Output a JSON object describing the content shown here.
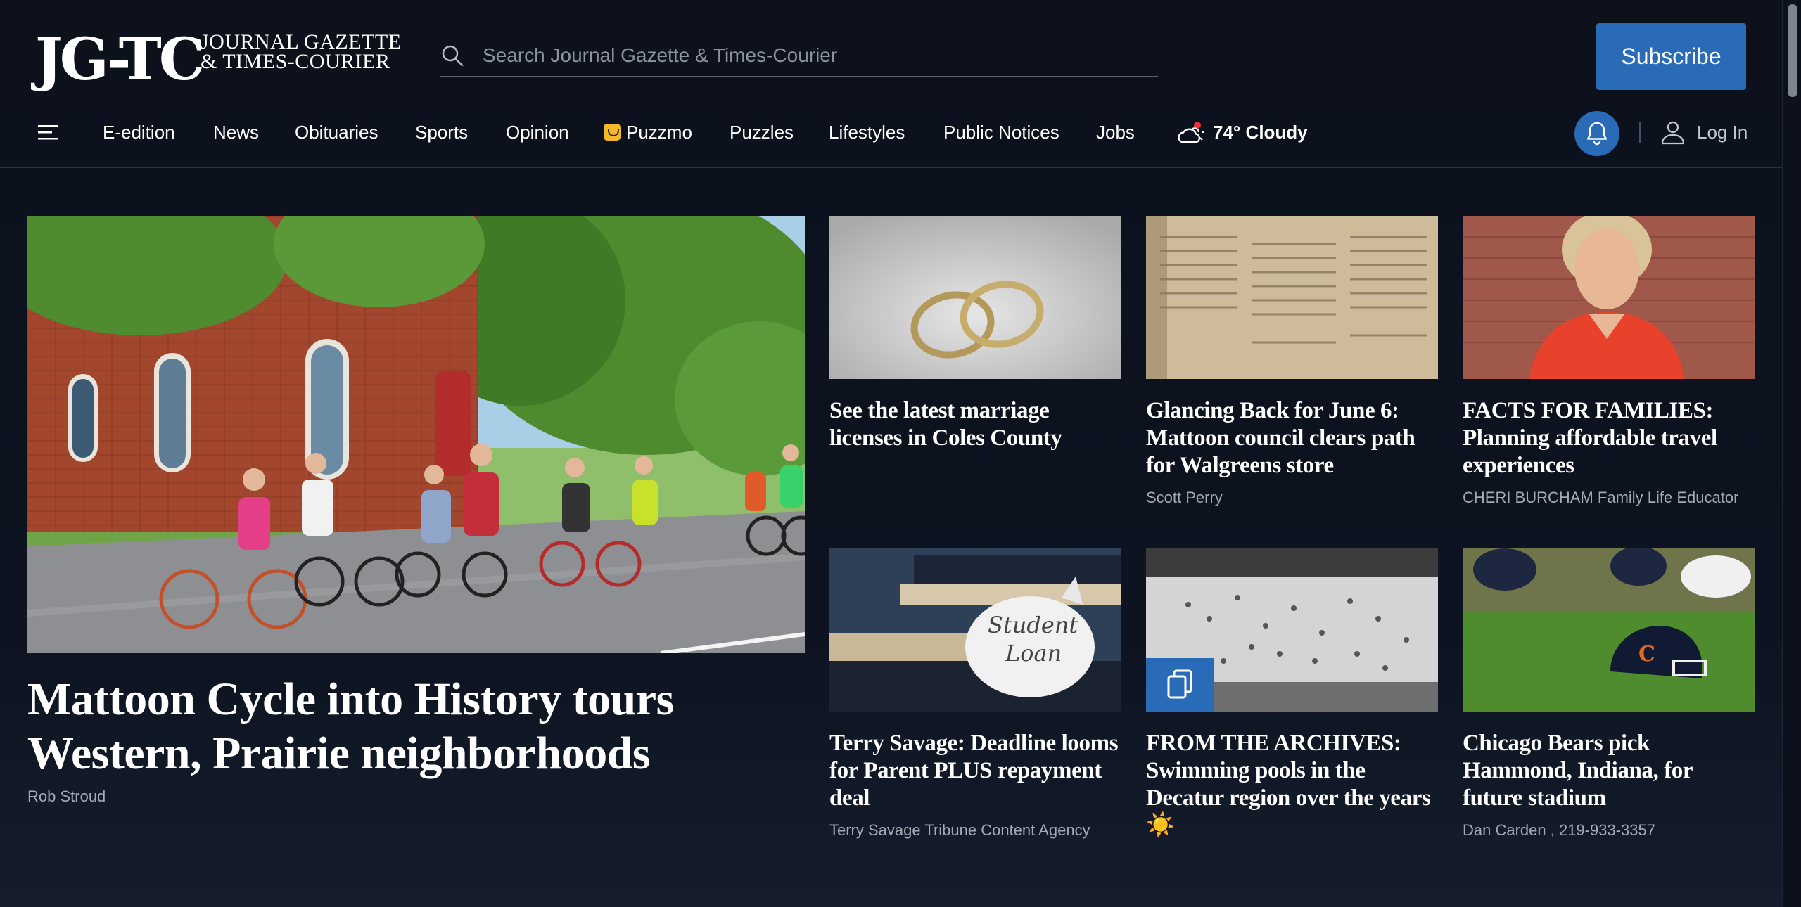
{
  "header": {
    "logo_mark": "JG-TC",
    "logo_line1": "JOURNAL GAZETTE",
    "logo_line2": "& TIMES-COURIER",
    "search_placeholder": "Search Journal Gazette & Times-Courier",
    "subscribe_label": "Subscribe"
  },
  "nav": {
    "items": [
      "E-edition",
      "News",
      "Obituaries",
      "Sports",
      "Opinion",
      "Puzzmo",
      "Puzzles",
      "Lifestyles",
      "Public Notices",
      "Jobs"
    ],
    "weather": "74° Cloudy",
    "login_label": "Log In"
  },
  "lead": {
    "headline": "Mattoon Cycle into History tours Western, Prairie neighborhoods",
    "byline": "Rob Stroud",
    "image": "group-of-cyclists-riding-past-brick-church"
  },
  "cards": [
    {
      "headline": "See the latest marriage licenses in Coles County",
      "byline": "",
      "image": "two-wedding-rings-on-glitter"
    },
    {
      "headline": "Glancing Back for June 6: Mattoon council clears path for Walgreens store",
      "byline": "Scott Perry",
      "image": "old-newspaper-page"
    },
    {
      "headline": "FACTS FOR FAMILIES: Planning affordable travel experiences",
      "byline": "CHERI BURCHAM Family Life Educator",
      "image": "woman-portrait-brick-wall"
    },
    {
      "headline": "Terry Savage: Deadline looms for Parent PLUS repayment deal",
      "byline": "Terry Savage Tribune Content Agency",
      "image": "student-loan-piggy-bank",
      "piggy_text_1": "Student",
      "piggy_text_2": "Loan"
    },
    {
      "headline": "FROM THE ARCHIVES: Swimming pools in the Decatur region over the years ☀️",
      "byline": "",
      "image": "vintage-swimming-pool-photo"
    },
    {
      "headline": "Chicago Bears pick Hammond, Indiana, for future stadium",
      "byline": "Dan Carden , 219-933-3357",
      "image": "bears-helmet-on-grass"
    }
  ],
  "colors": {
    "accent": "#2a6bb8",
    "background": "#0c111c",
    "byline": "#a4aab4"
  }
}
